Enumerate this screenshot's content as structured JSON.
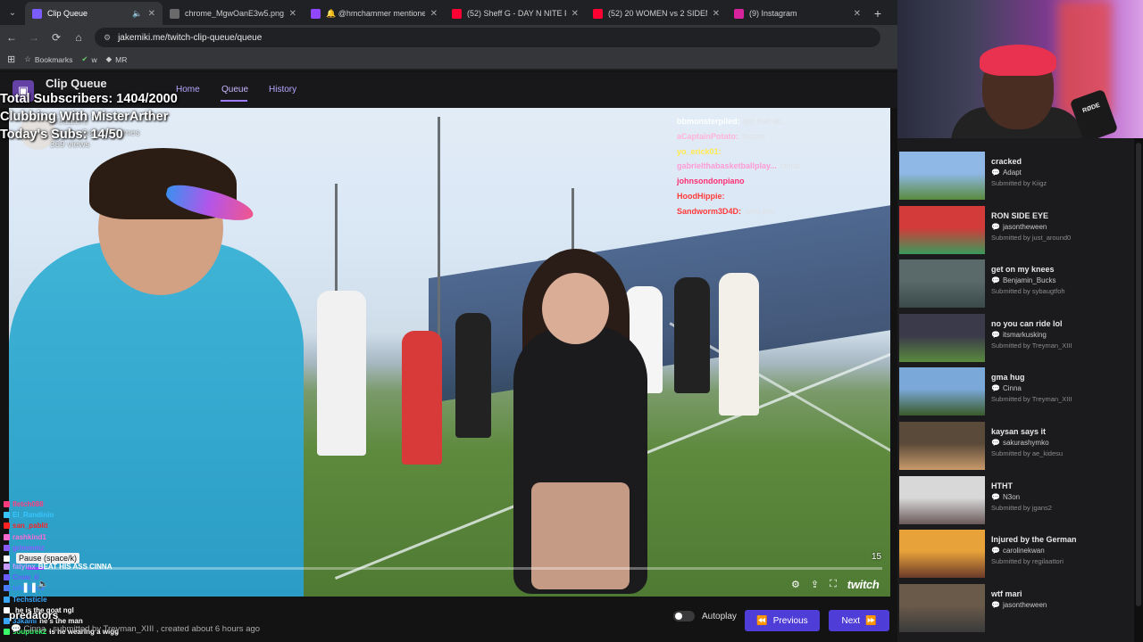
{
  "browser": {
    "tabs": [
      {
        "title": "Clip Queue",
        "color": "#7b5cff",
        "active": true
      },
      {
        "title": "chrome_MgwOanE3w5.png (4...",
        "color": "#6a6a6a"
      },
      {
        "title": "🔔 @hmchammer mentioned",
        "color": "#9147ff"
      },
      {
        "title": "(52) Sheff G - DAY N NITE Free",
        "color": "#ff0033"
      },
      {
        "title": "(52) 20 WOMEN vs 2 SIDEMEN",
        "color": "#ff0033"
      },
      {
        "title": "(9) Instagram",
        "color": "#d6249f"
      }
    ],
    "url": "jakemiki.me/twitch-clip-queue/queue",
    "bookmarks": [
      "Bookmarks",
      "w",
      "MR"
    ],
    "icons": {
      "back": "←",
      "forward": "→",
      "reload": "⟳",
      "home": "⌂",
      "close": "✕",
      "new_tab": "+",
      "menu": "⌄",
      "apps": "⊞",
      "mute": "🔈"
    }
  },
  "app": {
    "title": "Clip Queue",
    "nav": [
      "Home",
      "Queue",
      "History"
    ],
    "logo_icon": "▣"
  },
  "overlay": {
    "stats": [
      "Total Subscribers: 1404/2000",
      "Clubbing With MisterArther",
      "Today's Subs: 14/50"
    ],
    "clip_meta": [
      "predators",
      "Cinna · Gamer Games",
      "369 views"
    ],
    "pause_tip": "Pause (space/k)",
    "predators_label": "predators"
  },
  "top_chat": [
    {
      "user": "bbmonsterpiled:",
      "color": "#ffffff",
      "msg": "got that ab..."
    },
    {
      "user": "aCaptainPotato:",
      "color": "#ffb4d9",
      "msg": "buzzer"
    },
    {
      "user": "yo_erick01:",
      "color": "#ffea4a",
      "msg": ""
    },
    {
      "user": "gabrielthabasketballplay...",
      "color": "#ff9ad5",
      "msg": "cinna"
    },
    {
      "user": "johnsondonpiano",
      "color": "#ff2d72",
      "msg": ""
    },
    {
      "user": "HoodHippie:",
      "color": "#ff3a3a",
      "msg": ""
    },
    {
      "user": "Sandworm3D4D:",
      "color": "#ff3a3a",
      "msg": "omg bro"
    }
  ],
  "bottom_chat": [
    {
      "user": "fletch088",
      "color": "#ff3b7d",
      "msg": ""
    },
    {
      "user": "El_Randinio",
      "color": "#38c6ff",
      "msg": ""
    },
    {
      "user": "san_pablit",
      "color": "#ff2222",
      "msg": ""
    },
    {
      "user": "rashkind1",
      "color": "#ff6ad0",
      "msg": ""
    },
    {
      "user": "grimmmz",
      "color": "#8a5cff",
      "msg": ""
    },
    {
      "user": "",
      "color": "#ffffff",
      "msg": ""
    },
    {
      "user": "fatyinx",
      "color": "#c89cff",
      "msg": "BEAT HIS ASS CINNA"
    },
    {
      "user": "Crow_ti",
      "color": "#6a5cff",
      "msg": ""
    },
    {
      "user": "tehphone",
      "color": "#4a7bff",
      "msg": ""
    },
    {
      "user": "Techsticle",
      "color": "#38a8ff",
      "msg": ""
    },
    {
      "user": "",
      "color": "#ffffff",
      "msg": "he is the goat ngl"
    },
    {
      "user": "33kami",
      "color": "#38a8ff",
      "msg": "he's the man"
    },
    {
      "user": "souptrek2",
      "color": "#38ff6a",
      "msg": "is he wearing a wigg"
    }
  ],
  "player": {
    "time": "15",
    "progress": 0.02,
    "controls": {
      "settings": "⚙",
      "share": "⇪",
      "fullscreen": "⛶"
    },
    "brand": "twitch"
  },
  "clip_info": "Cinna , submitted by Treyman_XIII , created about 6 hours ago",
  "footer": {
    "autoplay": "Autoplay",
    "previous": "Previous",
    "next": "Next",
    "prev_icon": "⏪",
    "next_icon": "⏩"
  },
  "webcam": {
    "mic_label": "RØDE"
  },
  "queue": [
    {
      "title": "cracked",
      "author": "Adapt",
      "submitted": "Submitted by Kiigz",
      "thumb": [
        "#8fb8e6",
        "#5a8a3e"
      ]
    },
    {
      "title": "RON SIDE EYE",
      "author": "jasontheween",
      "submitted": "Submitted by just_around0",
      "thumb": [
        "#d33a3a",
        "#3a9a5a"
      ]
    },
    {
      "title": "get on my knees",
      "author": "Benjamin_Bucks",
      "submitted": "Submitted by sybaugtfoh",
      "thumb": [
        "#5a6a6a",
        "#3a4a4a"
      ]
    },
    {
      "title": "no you can ride lol",
      "author": "itsmarkusking",
      "submitted": "Submitted by Treyman_XIII",
      "thumb": [
        "#3a3a4a",
        "#5a8a3e"
      ]
    },
    {
      "title": "gma hug",
      "author": "Cinna",
      "submitted": "Submitted by Treyman_XIII",
      "thumb": [
        "#7aa8d8",
        "#3a5a2a"
      ]
    },
    {
      "title": "kaysan says it",
      "author": "sakurashymko",
      "submitted": "Submitted by ae_kidesu",
      "thumb": [
        "#5a4a3a",
        "#c89a6a"
      ]
    },
    {
      "title": "HTHT",
      "author": "N3on",
      "submitted": "Submitted by jgans2",
      "thumb": [
        "#d8d8d8",
        "#6a5a5a"
      ]
    },
    {
      "title": "Injured by the German",
      "author": "carolinekwan",
      "submitted": "Submitted by regilaattori",
      "thumb": [
        "#e8a23a",
        "#6a3a2a"
      ]
    },
    {
      "title": "wtf mari",
      "author": "jasontheween",
      "submitted": "",
      "thumb": [
        "#6a5a4a",
        "#3a3a3a"
      ]
    }
  ]
}
